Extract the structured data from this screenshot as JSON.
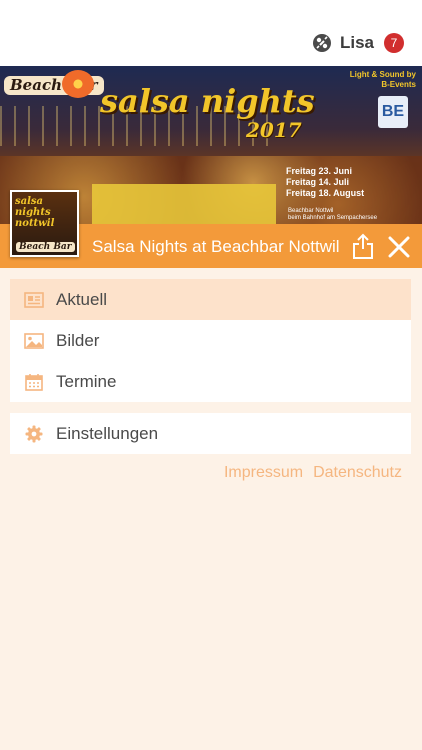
{
  "header": {
    "user_name": "Lisa",
    "notification_count": "7",
    "user_icon": "user-network-icon"
  },
  "banner": {
    "logo_text": "Beach Bar",
    "title": "salsa nights",
    "year": "2017",
    "light_sound": "Light & Sound by",
    "light_sound_by": "B-Events",
    "be_logo": "BE",
    "dates": [
      "Freitag 23. Juni",
      "Freitag 14. Juli",
      "Freitag 18. August"
    ],
    "venue": [
      "Beachbar Nottwil",
      "beim Bahnhof am Sempachersee"
    ],
    "thumb_title": "salsa nights nottwil",
    "thumb_logo": "Beach Bar"
  },
  "event_bar": {
    "title": "Salsa Nights at Beachbar Nottwil",
    "share_icon": "share-icon",
    "close_icon": "close-icon",
    "bar_color": "#f39a3a"
  },
  "menu": {
    "items": [
      {
        "label": "Aktuell",
        "icon": "newspaper-icon"
      },
      {
        "label": "Bilder",
        "icon": "image-icon"
      },
      {
        "label": "Termine",
        "icon": "calendar-icon"
      }
    ],
    "settings": {
      "label": "Einstellungen",
      "icon": "gear-icon"
    }
  },
  "footer": {
    "impressum": "Impressum",
    "datenschutz": "Datenschutz"
  },
  "colors": {
    "accent": "#f39a3a",
    "icon": "#f5b680",
    "background": "#fdf2e7",
    "badge": "#d12e2e"
  }
}
